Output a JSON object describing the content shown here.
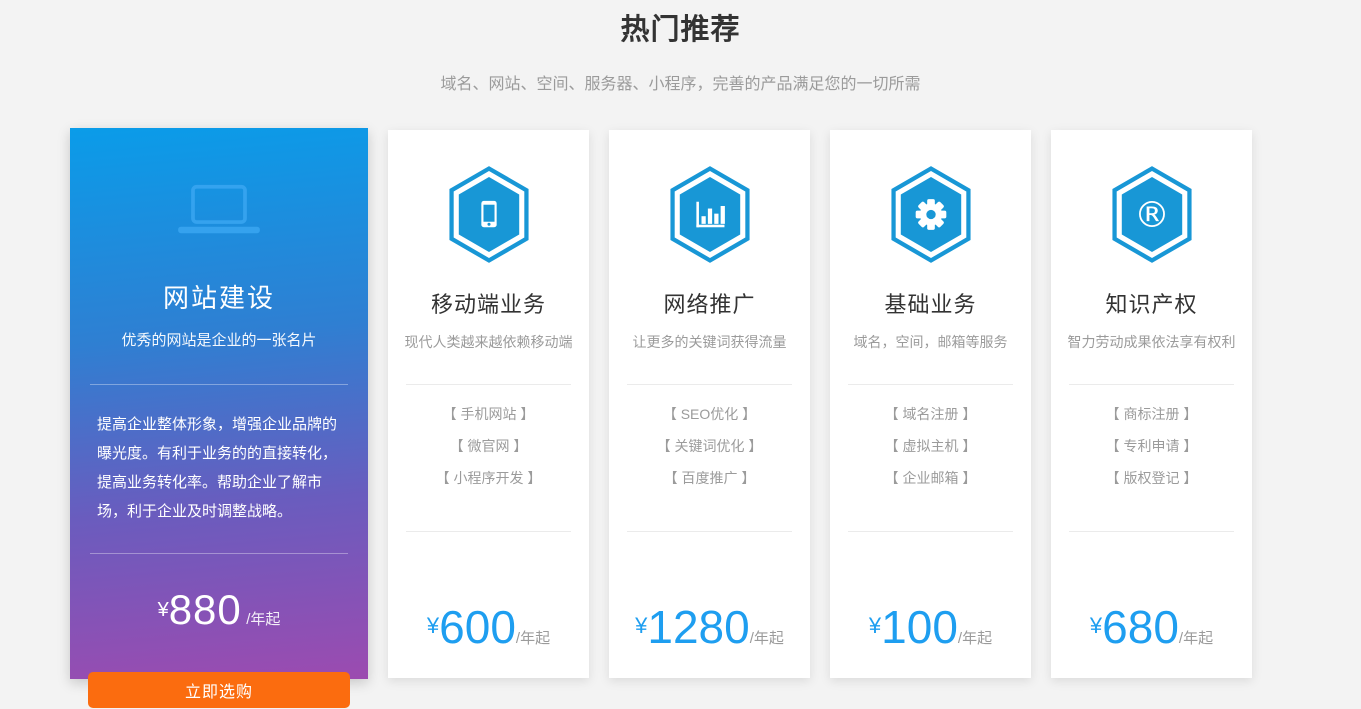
{
  "header": {
    "title": "热门推荐",
    "subtitle": "域名、网站、空间、服务器、小程序，完善的产品满足您的一切所需"
  },
  "featured_card": {
    "icon": "laptop-icon",
    "title": "网站建设",
    "subtitle": "优秀的网站是企业的一张名片",
    "description": "提高企业整体形象，增强企业品牌的曝光度。有利于业务的的直接转化，提高业务转化率。帮助企业了解市场，利于企业及时调整战略。",
    "currency": "¥",
    "price": "880",
    "price_unit": "/年起",
    "cta_label": "立即选购"
  },
  "cards": [
    {
      "icon": "smartphone-icon",
      "title": "移动端业务",
      "subtitle": "现代人类越来越依赖移动端",
      "items": [
        "【 手机网站 】",
        "【 微官网 】",
        "【 小程序开发 】"
      ],
      "currency": "¥",
      "price": "600",
      "price_unit": "/年起"
    },
    {
      "icon": "bar-chart-icon",
      "title": "网络推广",
      "subtitle": "让更多的关键词获得流量",
      "items": [
        "【 SEO优化 】",
        "【 关键词优化 】",
        "【 百度推广 】"
      ],
      "currency": "¥",
      "price": "1280",
      "price_unit": "/年起"
    },
    {
      "icon": "gear-icon",
      "title": "基础业务",
      "subtitle": "域名，空间，邮箱等服务",
      "items": [
        "【 域名注册 】",
        "【 虚拟主机 】",
        "【 企业邮箱 】"
      ],
      "currency": "¥",
      "price": "100",
      "price_unit": "/年起"
    },
    {
      "icon": "registered-trademark-icon",
      "title": "知识产权",
      "subtitle": "智力劳动成果依法享有权利",
      "items": [
        "【 商标注册 】",
        "【 专利申请 】",
        "【 版权登记 】"
      ],
      "currency": "¥",
      "price": "680",
      "price_unit": "/年起"
    }
  ],
  "colors": {
    "accent_blue": "#1e9ef0",
    "hexagon_blue": "#1897d6",
    "button_orange": "#fb6c0f",
    "gradient_top": "#0a9ce9",
    "gradient_bottom": "#9c4bb0",
    "page_background": "#f3f3f3"
  }
}
